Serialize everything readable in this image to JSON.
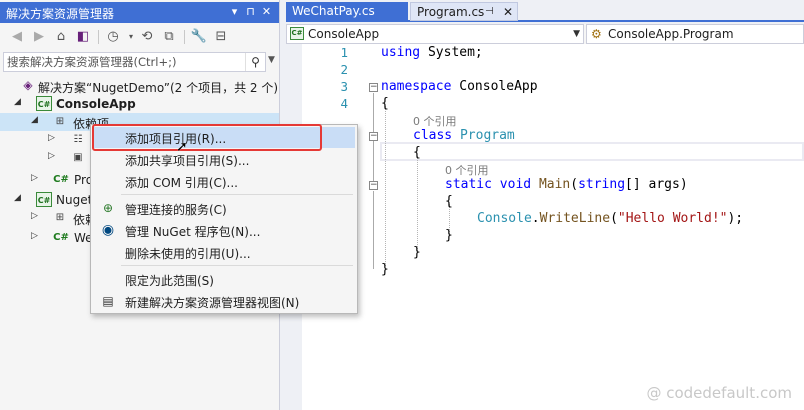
{
  "solution_explorer": {
    "title": "解决方案资源管理器",
    "title_buttons": [
      "▾",
      "⊓",
      "✕"
    ],
    "search_placeholder": "搜索解决方案资源管理器(Ctrl+;)",
    "tree": [
      {
        "label": "解决方案“NugetDemo”(2 个项目，共 2 个)",
        "icon": "solution-icon"
      },
      {
        "label": "ConsoleApp",
        "icon": "csharp-project-icon",
        "bold": true
      },
      {
        "label": "依赖项",
        "icon": "dependencies-icon",
        "selected": true
      },
      {
        "label": "",
        "icon": "analyzers-icon"
      },
      {
        "label": "",
        "icon": "frameworks-icon"
      },
      {
        "label": "Pro",
        "icon": "csharp-file-icon"
      },
      {
        "label": "Nuget",
        "icon": "csharp-project-icon"
      },
      {
        "label": "依赖",
        "icon": "dependencies-icon"
      },
      {
        "label": "We",
        "icon": "csharp-file-icon"
      }
    ]
  },
  "editor": {
    "tabs": [
      {
        "label": "WeChatPay.cs",
        "active": false
      },
      {
        "label": "Program.cs",
        "active": true
      }
    ],
    "nav_project": "ConsoleApp",
    "nav_class": "ConsoleApp.Program",
    "line_numbers": [
      "1",
      "2",
      "3",
      "4"
    ],
    "code": {
      "using_kw": "using",
      "using_rest": " System;",
      "namespace_kw": "namespace",
      "namespace_name": " ConsoleApp",
      "open_brace": "{",
      "close_brace": "}",
      "ref_hint": "0 个引用",
      "class_kw": "class",
      "class_name": "Program",
      "static_kw": "static",
      "void_kw": "void",
      "main_fn": "Main",
      "string_kw": "string",
      "args_rest": "[] args)",
      "paren_open": "(",
      "console_type": "Console",
      "writeline_fn": "WriteLine",
      "str_lit": "\"Hello World!\"",
      "dot": ".",
      "call_end": ");"
    }
  },
  "context_menu": {
    "items": [
      {
        "label": "添加项目引用(R)...",
        "icon": "",
        "highlighted": true
      },
      {
        "label": "添加共享项目引用(S)...",
        "icon": ""
      },
      {
        "label": "添加 COM 引用(C)...",
        "icon": ""
      },
      {
        "label": "管理连接的服务(C)",
        "icon": "connected-services-icon"
      },
      {
        "label": "管理 NuGet 程序包(N)...",
        "icon": "nuget-icon"
      },
      {
        "label": "删除未使用的引用(U)...",
        "icon": ""
      },
      {
        "label": "限定为此范围(S)",
        "icon": ""
      },
      {
        "label": "新建解决方案资源管理器视图(N)",
        "icon": "new-view-icon"
      }
    ]
  },
  "watermark": "@ codedefault.com",
  "colors": {
    "accent": "#3f6fd4",
    "highlight_border": "#e53935",
    "keyword": "#0000ff",
    "type": "#2b91af",
    "string": "#a31515"
  }
}
